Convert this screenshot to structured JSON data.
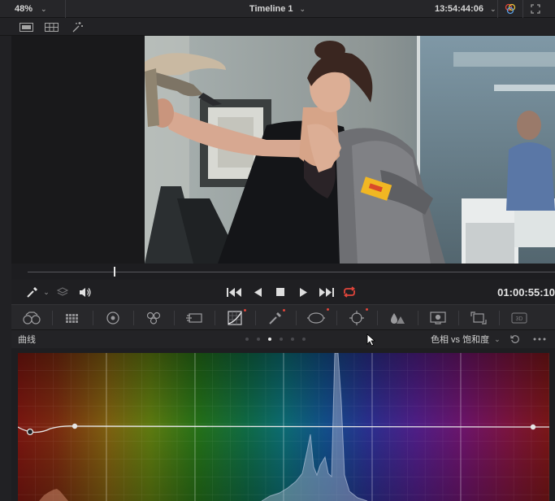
{
  "viewer": {
    "zoom": "48%",
    "timeline_name": "Timeline 1",
    "timecode": "13:54:44:06",
    "record_timecode": "01:00:55:10"
  },
  "curves": {
    "title": "曲线",
    "mode": "色相 vs 饱和度",
    "page_count": 6,
    "active_page": 3
  },
  "colors": {
    "accent": "#e0453b",
    "curve_line": "#e6e6e6"
  },
  "icons": {
    "viewer_options": [
      "single-viewer-icon",
      "grid-viewer-icon",
      "magic-wand-icon"
    ],
    "transport": [
      "eyedropper-icon",
      "layers-icon",
      "speaker-icon",
      "skip-to-start-icon",
      "play-reverse-icon",
      "stop-icon",
      "play-icon",
      "skip-to-end-icon",
      "loop-icon"
    ],
    "tools": [
      "camera-raw-icon",
      "color-match-icon",
      "color-wheels-icon",
      "rgb-mixer-icon",
      "motion-effects-icon",
      "curves-icon",
      "qualifier-icon",
      "window-icon",
      "tracker-icon",
      "blur-icon",
      "key-icon",
      "sizing-icon",
      "3d-icon"
    ]
  }
}
